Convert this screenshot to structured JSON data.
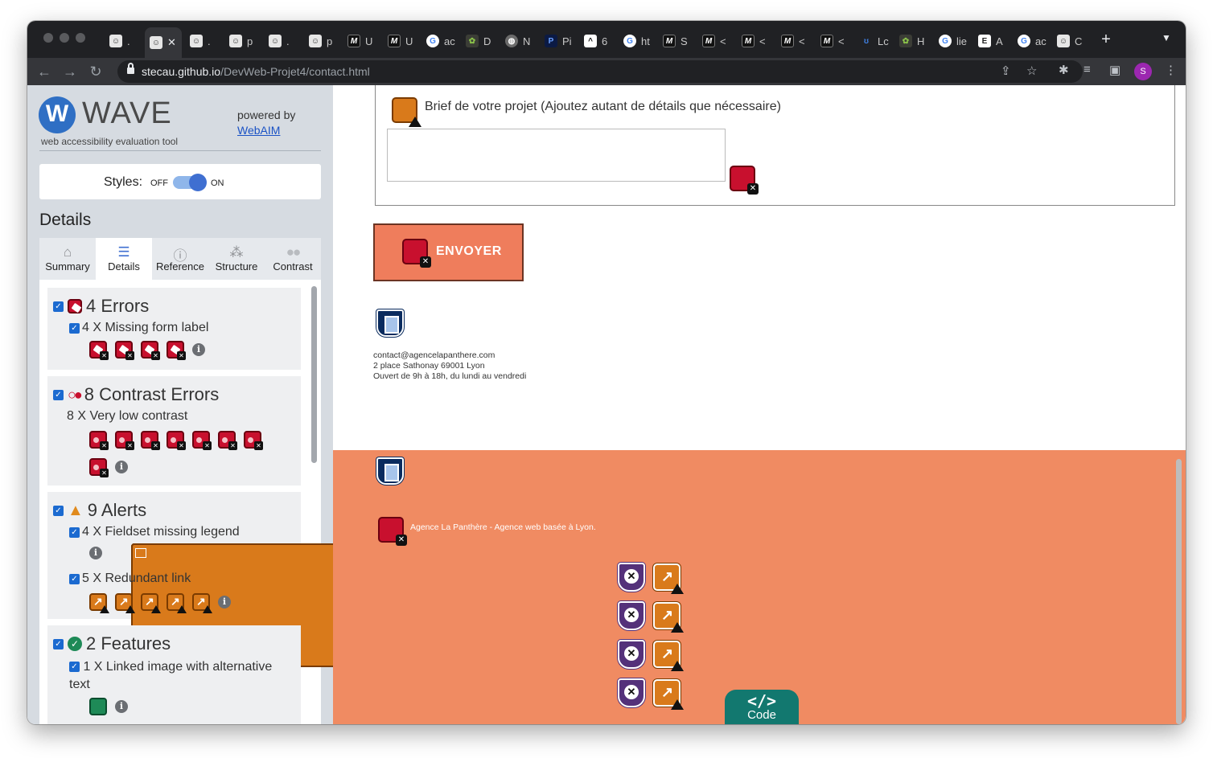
{
  "browser": {
    "tabs": [
      {
        "label": "."
      },
      {
        "label": ""
      },
      {
        "label": "."
      },
      {
        "label": "p"
      },
      {
        "label": "."
      },
      {
        "label": "p"
      },
      {
        "label": "U"
      },
      {
        "label": "U"
      },
      {
        "label": "ac"
      },
      {
        "label": "D"
      },
      {
        "label": "N"
      },
      {
        "label": "Pi"
      },
      {
        "label": "6"
      },
      {
        "label": "ht"
      },
      {
        "label": "S"
      },
      {
        "label": "<"
      },
      {
        "label": "<"
      },
      {
        "label": "<"
      },
      {
        "label": "<"
      },
      {
        "label": "Lc"
      },
      {
        "label": "H"
      },
      {
        "label": "lie"
      },
      {
        "label": "A"
      },
      {
        "label": "ac"
      },
      {
        "label": "C"
      }
    ],
    "new_tab": "+",
    "url_domain": "stecau.github.io",
    "url_path": "/DevWeb-Projet4/contact.html",
    "profile_initial": "S"
  },
  "wave": {
    "logo_letter": "W",
    "title": "WAVE",
    "subtitle": "web accessibility evaluation tool",
    "powered_by": "powered by",
    "webaim": "WebAIM",
    "styles_label": "Styles:",
    "styles_off": "OFF",
    "styles_on": "ON",
    "details_heading": "Details",
    "tabs": [
      "Summary",
      "Details",
      "Reference",
      "Structure",
      "Contrast"
    ],
    "errors": {
      "title": "4 Errors",
      "sub": "4 X Missing form label"
    },
    "contrast": {
      "title": "8 Contrast Errors",
      "sub": "8 X Very low contrast"
    },
    "alerts": {
      "title": "9 Alerts",
      "sub1": "4 X Fieldset missing legend",
      "sub2": "5 X Redundant link"
    },
    "features": {
      "title": "2 Features",
      "sub": "1 X Linked image with alternative text"
    }
  },
  "page": {
    "brief_label": "Brief de votre projet (Ajoutez autant de détails que nécessaire)",
    "submit_label": "ENVOYER",
    "contact_email": "contact@agencelapanthere.com",
    "contact_address": "2 place Sathonay 69001 Lyon",
    "contact_hours": "Ouvert de 9h à 18h, du lundi au vendredi",
    "footer_text": "Agence La Panthère - Agence web basée à Lyon.",
    "code_symbol": "</>",
    "code_label": "Code"
  }
}
